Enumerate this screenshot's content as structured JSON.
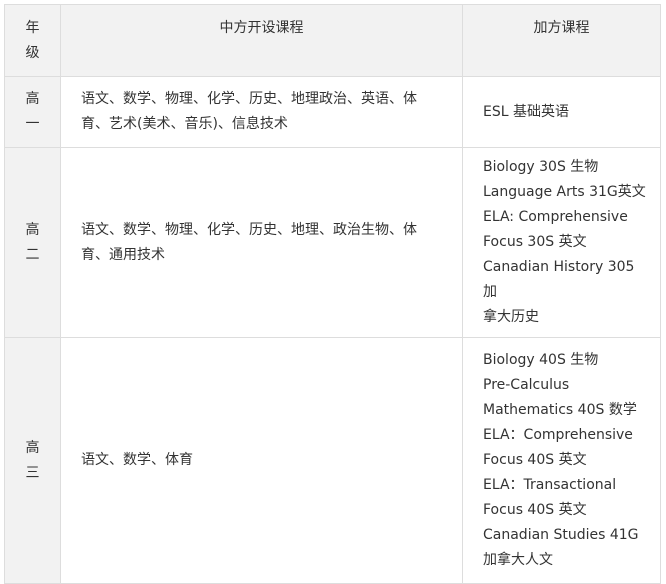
{
  "table": {
    "headers": {
      "grade": [
        "年",
        "级"
      ],
      "chinese_courses": "中方开设课程",
      "canadian_courses": "加方课程"
    },
    "rows": [
      {
        "grade": [
          "高",
          "一"
        ],
        "chinese_lines": [
          "语文、数学、物理、化学、历史、地理政治、英语、体",
          "育、艺术(美术、音乐)、信息技术"
        ],
        "canadian_lines": [
          "ESL 基础英语"
        ]
      },
      {
        "grade": [
          "高",
          "二"
        ],
        "chinese_lines": [
          "语文、数学、物理、化学、历史、地理、政治生物、体",
          "育、通用技术"
        ],
        "canadian_lines": [
          "Biology 30S 生物",
          "Language Arts 31G英文",
          "ELA: Comprehensive",
          "Focus 30S 英文",
          "Canadian History 305 加",
          "拿大历史"
        ]
      },
      {
        "grade": [
          "高",
          "三"
        ],
        "chinese_lines": [
          "语文、数学、体育"
        ],
        "canadian_lines": [
          "Biology 40S 生物",
          "Pre-Calculus",
          "Mathematics 40S 数学",
          "ELA：Comprehensive",
          "Focus 40S 英文",
          "ELA：Transactional",
          "Focus 40S 英文",
          "Canadian Studies 41G",
          "加拿大人文"
        ]
      }
    ]
  }
}
